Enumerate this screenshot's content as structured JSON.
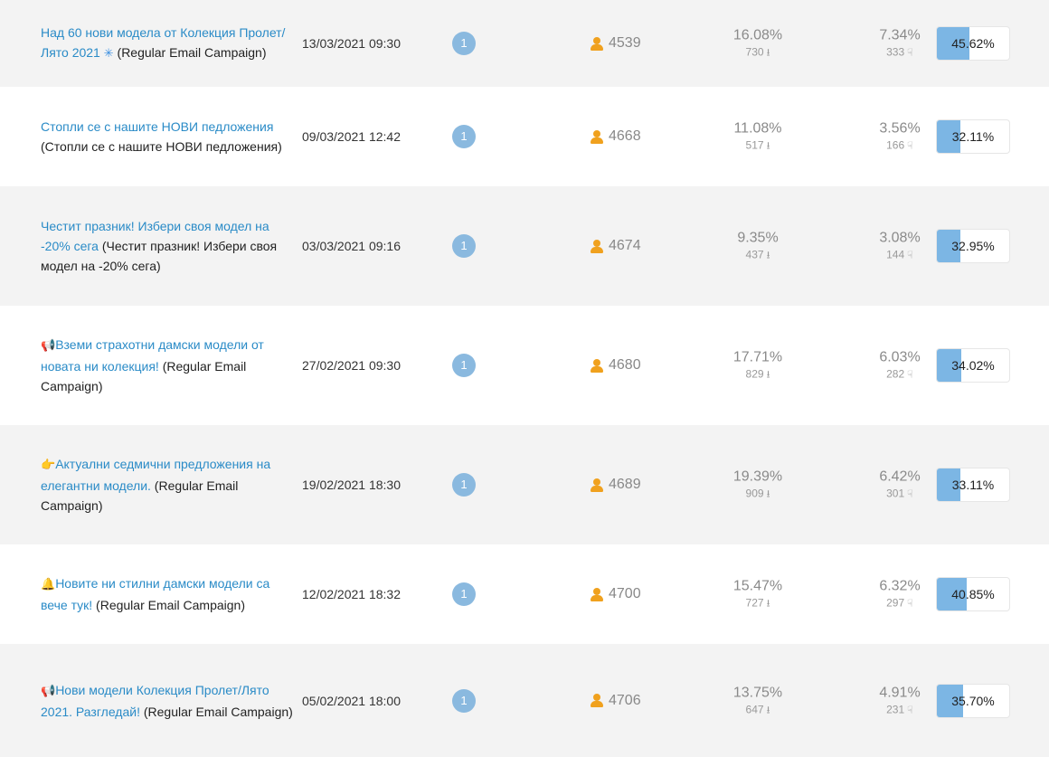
{
  "campaigns": [
    {
      "name_link": "Над 60 нови модела от Колекция Пролет/Лято 2021",
      "emoji": "✳",
      "emoji_type": "star",
      "emoji_pos": "after",
      "name_suffix": " (Regular Email Campaign)",
      "date": "13/03/2021 09:30",
      "badge": "1",
      "recipients": "4539",
      "open_pct": "16.08%",
      "open_count": "730",
      "click_pct": "7.34%",
      "click_count": "333",
      "rate": "45.62%",
      "rate_value": 45.62
    },
    {
      "name_link": "Стопли се с нашите НОВИ педложения",
      "emoji": "",
      "emoji_type": "",
      "emoji_pos": "",
      "name_suffix": " (Стопли се с нашите НОВИ педложения)",
      "date": "09/03/2021 12:42",
      "badge": "1",
      "recipients": "4668",
      "open_pct": "11.08%",
      "open_count": "517",
      "click_pct": "3.56%",
      "click_count": "166",
      "rate": "32.11%",
      "rate_value": 32.11
    },
    {
      "name_link": "Честит празник! Избери своя модел на -20% сега",
      "emoji": "",
      "emoji_type": "",
      "emoji_pos": "",
      "name_suffix": " (Честит празник! Избери своя модел на -20% сега)",
      "date": "03/03/2021 09:16",
      "badge": "1",
      "recipients": "4674",
      "open_pct": "9.35%",
      "open_count": "437",
      "click_pct": "3.08%",
      "click_count": "144",
      "rate": "32.95%",
      "rate_value": 32.95
    },
    {
      "name_link": "Вземи страхотни дамски модели от новата ни колекция!",
      "emoji": "📢",
      "emoji_type": "mega",
      "emoji_pos": "before",
      "name_suffix": " (Regular Email Campaign)",
      "date": "27/02/2021 09:30",
      "badge": "1",
      "recipients": "4680",
      "open_pct": "17.71%",
      "open_count": "829",
      "click_pct": "6.03%",
      "click_count": "282",
      "rate": "34.02%",
      "rate_value": 34.02
    },
    {
      "name_link": "Актуални седмични предложения на елегантни модели.",
      "emoji": "👉",
      "emoji_type": "hand",
      "emoji_pos": "before",
      "name_suffix": " (Regular Email Campaign)",
      "date": "19/02/2021 18:30",
      "badge": "1",
      "recipients": "4689",
      "open_pct": "19.39%",
      "open_count": "909",
      "click_pct": "6.42%",
      "click_count": "301",
      "rate": "33.11%",
      "rate_value": 33.11
    },
    {
      "name_link": "Новите ни стилни дамски модели са вече тук!",
      "emoji": "🔔",
      "emoji_type": "bell",
      "emoji_pos": "before",
      "name_suffix": " (Regular Email Campaign)",
      "date": "12/02/2021 18:32",
      "badge": "1",
      "recipients": "4700",
      "open_pct": "15.47%",
      "open_count": "727",
      "click_pct": "6.32%",
      "click_count": "297",
      "rate": "40.85%",
      "rate_value": 40.85
    },
    {
      "name_link": "Нови модели Колекция Пролет/Лято 2021. Разгледай!",
      "emoji": "📢",
      "emoji_type": "mega",
      "emoji_pos": "before",
      "name_suffix": " (Regular Email Campaign)",
      "date": "05/02/2021 18:00",
      "badge": "1",
      "recipients": "4706",
      "open_pct": "13.75%",
      "open_count": "647",
      "click_pct": "4.91%",
      "click_count": "231",
      "rate": "35.70%",
      "rate_value": 35.7
    }
  ],
  "icons": {
    "recipients": "person-icon",
    "opens": "download-icon",
    "clicks": "pointer-hand-icon"
  },
  "colors": {
    "link": "#2a8bc7",
    "badge": "#8ab9df",
    "person": "#f0a11e",
    "bar_fill": "#7cb6e4",
    "row_alt": "#f3f3f3"
  }
}
